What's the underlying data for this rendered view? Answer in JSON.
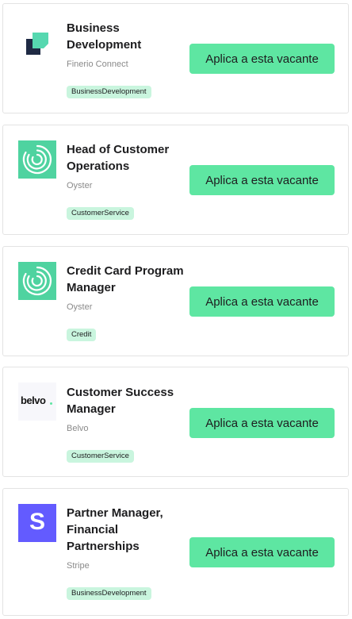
{
  "jobs": [
    {
      "title": "Business Development",
      "company": "Finerio Connect",
      "tag": "BusinessDevelopment",
      "apply_label": "Aplica a esta vacante",
      "logo_icon": "finerio-logo-icon"
    },
    {
      "title": "Head of Customer Operations",
      "company": "Oyster",
      "tag": "CustomerService",
      "apply_label": "Aplica a esta vacante",
      "logo_icon": "oyster-logo-icon"
    },
    {
      "title": "Credit Card Program Manager",
      "company": "Oyster",
      "tag": "Credit",
      "apply_label": "Aplica a esta vacante",
      "logo_icon": "oyster-logo-icon"
    },
    {
      "title": "Customer Success Manager",
      "company": "Belvo",
      "tag": "CustomerService",
      "apply_label": "Aplica a esta vacante",
      "logo_icon": "belvo-logo-icon",
      "logo_text": "belvo"
    },
    {
      "title": "Partner Manager, Financial Partnerships",
      "company": "Stripe",
      "tag": "BusinessDevelopment",
      "apply_label": "Aplica a esta vacante",
      "logo_icon": "stripe-logo-icon",
      "logo_text": "S"
    }
  ],
  "colors": {
    "accent": "#5ee6a2",
    "tag_bg": "#c9f5de",
    "oyster": "#4fd3a0",
    "stripe": "#635bff",
    "finerio_dark": "#1f2a44",
    "finerio_light": "#56d8b0"
  }
}
